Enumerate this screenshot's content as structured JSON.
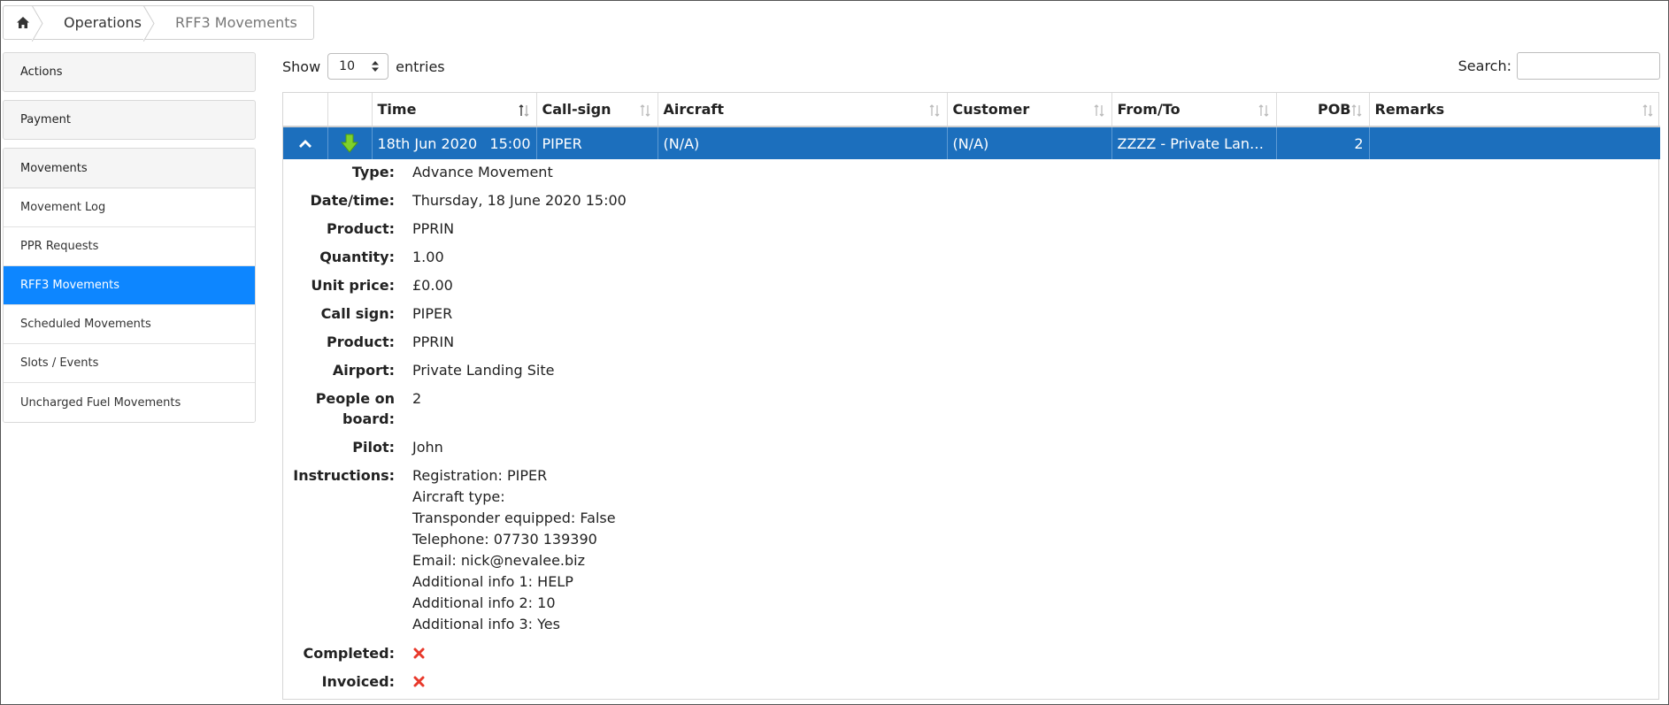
{
  "breadcrumb": {
    "home_icon": "home-icon",
    "items": [
      "Operations",
      "RFF3 Movements"
    ]
  },
  "sidebar": {
    "groups": [
      "Actions",
      "Payment"
    ],
    "movements_header": "Movements",
    "links": [
      {
        "label": "Movement Log",
        "active": false
      },
      {
        "label": "PPR Requests",
        "active": false
      },
      {
        "label": "RFF3 Movements",
        "active": true
      },
      {
        "label": "Scheduled Movements",
        "active": false
      },
      {
        "label": "Slots / Events",
        "active": false
      },
      {
        "label": "Uncharged Fuel Movements",
        "active": false
      }
    ]
  },
  "controls": {
    "show_label": "Show",
    "entries_value": "10",
    "entries_label": "entries",
    "search_label": "Search:",
    "search_value": ""
  },
  "table": {
    "columns": [
      "Time",
      "Call-sign",
      "Aircraft",
      "Customer",
      "From/To",
      "POB",
      "Remarks"
    ],
    "row": {
      "date": "18th Jun 2020",
      "time": "15:00",
      "callsign": "PIPER",
      "aircraft": "(N/A)",
      "customer": "(N/A)",
      "from_to": "ZZZZ - Private Landing...",
      "pob": "2",
      "remarks": "",
      "direction_icon": "arrow-down-icon",
      "collapse_icon": "chevron-up-icon"
    }
  },
  "detail": {
    "labels": {
      "type": "Type:",
      "datetime": "Date/time:",
      "product": "Product:",
      "quantity": "Quantity:",
      "unit_price": "Unit price:",
      "call_sign": "Call sign:",
      "product2": "Product:",
      "airport": "Airport:",
      "pob": "People on board:",
      "pilot": "Pilot:",
      "instructions": "Instructions:",
      "completed": "Completed:",
      "invoiced": "Invoiced:"
    },
    "values": {
      "type": "Advance Movement",
      "datetime": "Thursday, 18 June 2020 15:00",
      "product": "PPRIN",
      "quantity": "1.00",
      "unit_price": "£0.00",
      "call_sign": "PIPER",
      "product2": "PPRIN",
      "airport": "Private Landing Site",
      "pob": "2",
      "pilot": "John",
      "instructions": [
        "Registration: PIPER",
        "Aircraft type:",
        "Transponder equipped: False",
        "Telephone: 07730 139390",
        "Email: nick@nevalee.biz",
        "Additional info 1: HELP",
        "Additional info 2: 10",
        "Additional info 3: Yes"
      ],
      "completed": false,
      "invoiced": false
    },
    "status_icon": "cross-icon"
  },
  "colors": {
    "row_selected": "#1c6fbd",
    "sidebar_active": "#0d86ff",
    "cross": "#e8392b",
    "arrow": "#7fd12c"
  }
}
